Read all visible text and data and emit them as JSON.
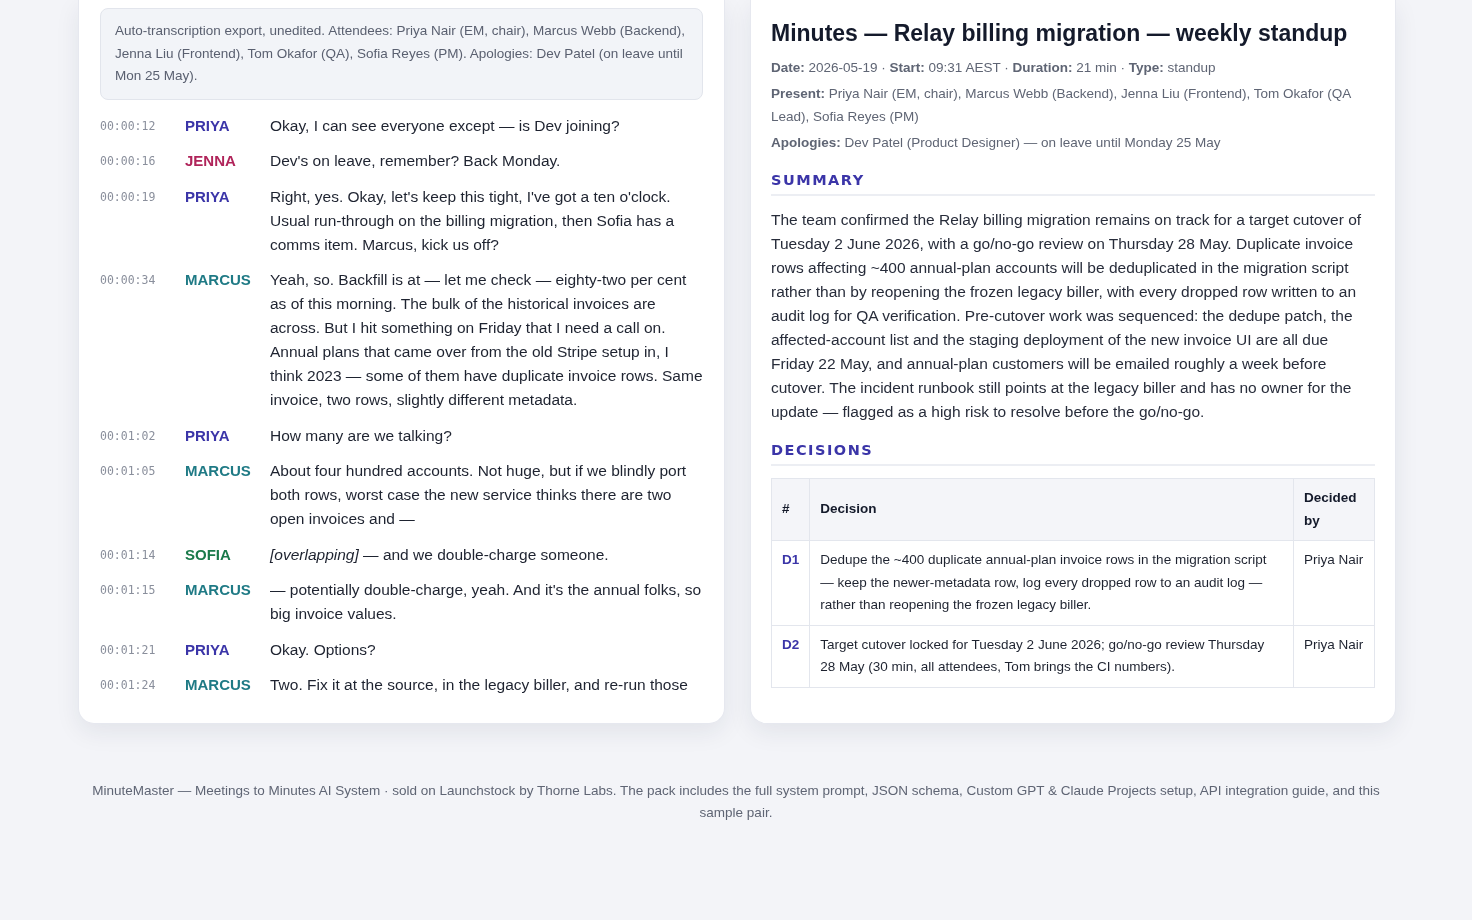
{
  "transcript": {
    "note": "Auto-transcription export, unedited. Attendees: Priya Nair (EM, chair), Marcus Webb (Backend), Jenna Liu (Frontend), Tom Okafor (QA), Sofia Reyes (PM). Apologies: Dev Patel (on leave until Mon 25 May).",
    "lines": [
      {
        "time": "00:00:12",
        "speaker": "PRIYA",
        "color": "#3b35a8",
        "text": "Okay, I can see everyone except — is Dev joining?"
      },
      {
        "time": "00:00:16",
        "speaker": "JENNA",
        "color": "#b0245a",
        "text": "Dev's on leave, remember? Back Monday."
      },
      {
        "time": "00:00:19",
        "speaker": "PRIYA",
        "color": "#3b35a8",
        "text": "Right, yes. Okay, let's keep this tight, I've got a ten o'clock. Usual run-through on the billing migration, then Sofia has a comms item. Marcus, kick us off?"
      },
      {
        "time": "00:00:34",
        "speaker": "MARCUS",
        "color": "#1f7a85",
        "text": "Yeah, so. Backfill is at — let me check — eighty-two per cent as of this morning. The bulk of the historical invoices are across. But I hit something on Friday that I need a call on. Annual plans that came over from the old Stripe setup in, I think 2023 — some of them have duplicate invoice rows. Same invoice, two rows, slightly different metadata."
      },
      {
        "time": "00:01:02",
        "speaker": "PRIYA",
        "color": "#3b35a8",
        "text": "How many are we talking?"
      },
      {
        "time": "00:01:05",
        "speaker": "MARCUS",
        "color": "#1f7a85",
        "text": "About four hundred accounts. Not huge, but if we blindly port both rows, worst case the new service thinks there are two open invoices and —"
      },
      {
        "time": "00:01:14",
        "speaker": "SOFIA",
        "color": "#1a7a4a",
        "text": "*[overlapping]* — and we double-charge someone."
      },
      {
        "time": "00:01:15",
        "speaker": "MARCUS",
        "color": "#1f7a85",
        "text": "— potentially double-charge, yeah. And it's the annual folks, so big invoice values."
      },
      {
        "time": "00:01:21",
        "speaker": "PRIYA",
        "color": "#3b35a8",
        "text": "Okay. Options?"
      },
      {
        "time": "00:01:24",
        "speaker": "MARCUS",
        "color": "#1f7a85",
        "text": "Two. Fix it at the source, in the legacy biller, and re-run those"
      }
    ]
  },
  "minutes": {
    "title": "Minutes — Relay billing migration — weekly standup",
    "meta": [
      "**Date:** 2026-05-19 · **Start:** 09:31 AEST · **Duration:** 21 min · **Type:** standup",
      "**Present:** Priya Nair (EM, chair), Marcus Webb (Backend), Jenna Liu (Frontend), Tom Okafor (QA Lead), Sofia Reyes (PM)",
      "**Apologies:** Dev Patel (Product Designer) — on leave until Monday 25 May"
    ],
    "summary_heading": "SUMMARY",
    "summary": "The team confirmed the Relay billing migration remains on track for a target cutover of Tuesday 2 June 2026, with a go/no-go review on Thursday 28 May. Duplicate invoice rows affecting ~400 annual-plan accounts will be deduplicated in the migration script rather than by reopening the frozen legacy biller, with every dropped row written to an audit log for QA verification. Pre-cutover work was sequenced: the dedupe patch, the affected-account list and the staging deployment of the new invoice UI are all due Friday 22 May, and annual-plan customers will be emailed roughly a week before cutover. The incident runbook still points at the legacy biller and has no owner for the update — flagged as a high risk to resolve before the go/no-go.",
    "decisions_heading": "DECISIONS",
    "table": {
      "columns": [
        "#",
        "Decision",
        "Decided by"
      ],
      "rows": [
        {
          "id": "D1",
          "decision": "Dedupe the ~400 duplicate annual-plan invoice rows in the migration script — keep the newer-metadata row, log every dropped row to an audit log — rather than reopening the frozen legacy biller.",
          "by": "Priya Nair"
        },
        {
          "id": "D2",
          "decision": "Target cutover locked for Tuesday 2 June 2026; go/no-go review Thursday 28 May (30 min, all attendees, Tom brings the CI numbers).",
          "by": "Priya Nair"
        }
      ]
    }
  },
  "footer": "MinuteMaster — Meetings to Minutes AI System · sold on Launchstock by Thorne Labs. The pack includes the full system prompt, JSON schema, Custom GPT & Claude Projects setup, API integration guide, and this sample pair."
}
